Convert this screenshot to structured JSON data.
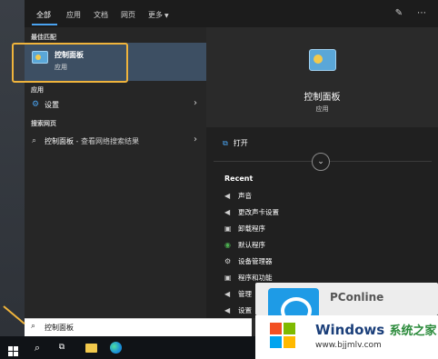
{
  "tabs": [
    {
      "label": "全部",
      "active": true
    },
    {
      "label": "应用",
      "active": false
    },
    {
      "label": "文档",
      "active": false
    },
    {
      "label": "网页",
      "active": false
    },
    {
      "label": "更多",
      "active": false
    }
  ],
  "results": {
    "best_match_header": "最佳匹配",
    "best_match": {
      "title": "控制面板",
      "subtitle": "应用",
      "icon": "control-panel-icon"
    },
    "apps_header": "应用",
    "apps": [
      {
        "label": "设置",
        "icon": "gear-icon"
      }
    ],
    "web_header": "搜索网页",
    "web": [
      {
        "label": "控制面板",
        "suffix": " - 查看网络搜索结果",
        "icon": "search-icon"
      }
    ]
  },
  "detail": {
    "title": "控制面板",
    "subtitle": "应用",
    "open_label": "打开",
    "recent_header": "Recent",
    "recent": [
      {
        "label": "声音",
        "icon": "speaker-icon"
      },
      {
        "label": "更改声卡设置",
        "icon": "speaker-icon"
      },
      {
        "label": "卸载程序",
        "icon": "programs-icon"
      },
      {
        "label": "默认程序",
        "icon": "default-programs-icon"
      },
      {
        "label": "设备管理器",
        "icon": "device-manager-icon"
      },
      {
        "label": "程序和功能",
        "icon": "programs-icon"
      },
      {
        "label": "管理",
        "icon": "speaker-icon"
      },
      {
        "label": "设置",
        "icon": "settings-icon"
      }
    ]
  },
  "search": {
    "value": "控制面板",
    "icon": "search-icon"
  },
  "watermark": {
    "brand": "PConline",
    "windows": "Windows",
    "cn": "系统之家",
    "url": "www.bjjmlv.com"
  },
  "colors": {
    "accent": "#4aa3f0",
    "highlight_border": "#f0b43c",
    "selected_bg": "#3d4f63"
  }
}
